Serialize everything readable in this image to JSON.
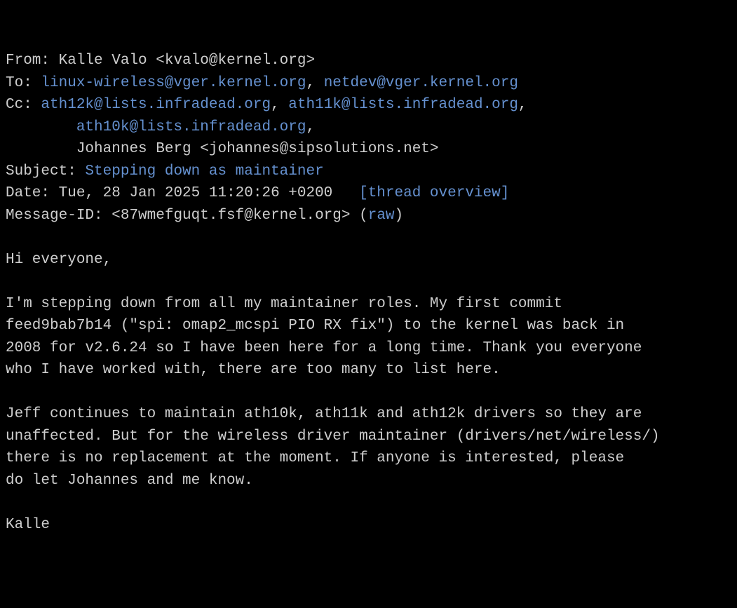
{
  "headers": {
    "from_label": "From: ",
    "from_name": "Kalle Valo <kvalo@kernel.org>",
    "to_label": "To: ",
    "to_link1": "linux-wireless@vger.kernel.org",
    "to_sep": ", ",
    "to_link2": "netdev@vger.kernel.org",
    "cc_label": "Cc: ",
    "cc_link1": "ath12k@lists.infradead.org",
    "cc_sep1": ", ",
    "cc_link2": "ath11k@lists.infradead.org",
    "cc_sep2": ",",
    "cc_indent1": "\t",
    "cc_link3": "ath10k@lists.infradead.org",
    "cc_sep3": ",",
    "cc_indent2": "\t",
    "cc_name": "Johannes Berg <johannes@sipsolutions.net>",
    "subject_label": "Subject: ",
    "subject_link": "Stepping down as maintainer",
    "date_label": "Date: ",
    "date_value": "Tue, 28 Jan 2025 11:20:26 +0200",
    "date_sep": "\t",
    "thread_overview": "[thread overview]",
    "msgid_label": "Message-ID: ",
    "msgid_value": "<87wmefguqt.fsf@kernel.org>",
    "msgid_paren_open": " (",
    "raw_link": "raw",
    "msgid_paren_close": ")"
  },
  "body": {
    "greeting": "Hi everyone,",
    "para1": "I'm stepping down from all my maintainer roles. My first commit\nfeed9bab7b14 (\"spi: omap2_mcspi PIO RX fix\") to the kernel was back in\n2008 for v2.6.24 so I have been here for a long time. Thank you everyone\nwho I have worked with, there are too many to list here.",
    "para2": "Jeff continues to maintain ath10k, ath11k and ath12k drivers so they are\nunaffected. But for the wireless driver maintainer (drivers/net/wireless/)\nthere is no replacement at the moment. If anyone is interested, please\ndo let Johannes and me know.",
    "signature": "Kalle"
  }
}
